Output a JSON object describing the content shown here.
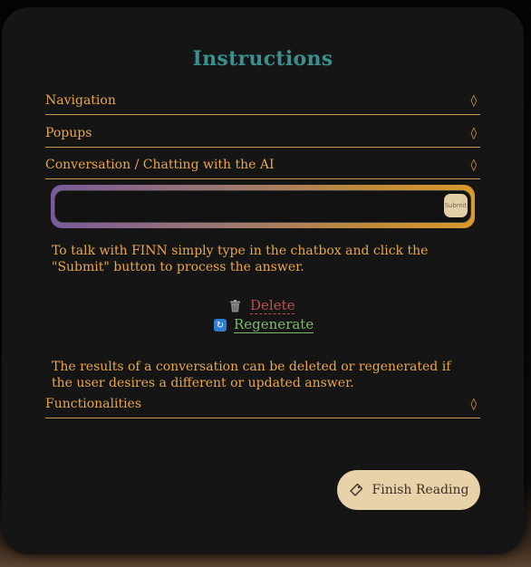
{
  "title": "Instructions",
  "accordion": [
    {
      "label": "Navigation",
      "icon": "updown-icon"
    },
    {
      "label": "Popups",
      "icon": "updown-icon"
    },
    {
      "label": "Conversation / Chatting with the AI",
      "icon": "updown-icon"
    },
    {
      "label": "Functionalities",
      "icon": "updown-icon"
    }
  ],
  "chat": {
    "placeholder": "",
    "submit_label": "Submit"
  },
  "paragraphs": {
    "chat_help": "To talk with FINN simply type in the chatbox and click the \"Submit\" button to process the answer.",
    "results_help": "The results of a conversation can be deleted or regenerated if the user desires a different or updated answer."
  },
  "actions": {
    "delete_label": "Delete",
    "regenerate_label": "Regenerate"
  },
  "finish": {
    "label": "Finish Reading"
  },
  "colors": {
    "title": "#3a8f8f",
    "text": "#e8a64e",
    "delete": "#c0504a",
    "regenerate": "#7dba6a",
    "button": "#e8d2aa"
  }
}
